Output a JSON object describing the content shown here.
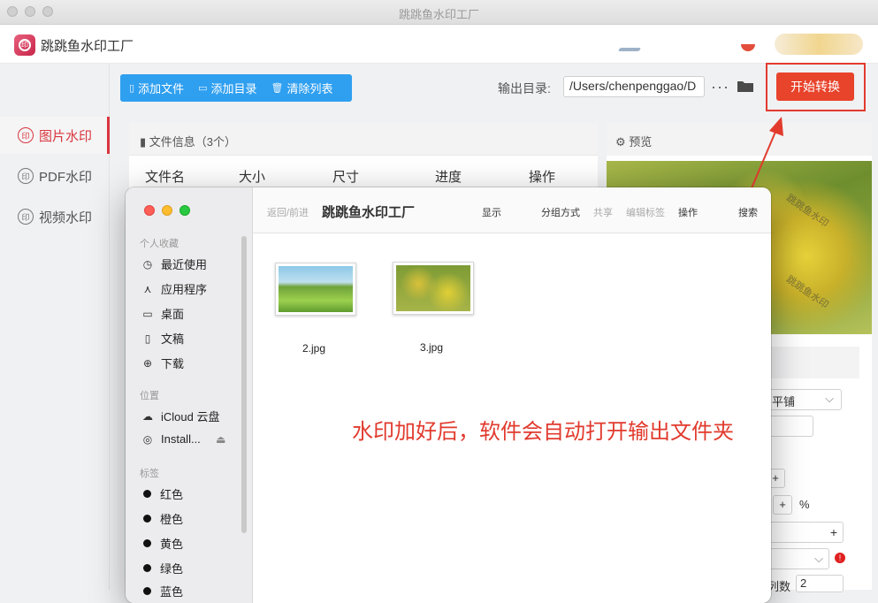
{
  "window": {
    "title": "跳跳鱼水印工厂"
  },
  "app": {
    "name": "跳跳鱼水印工厂"
  },
  "sidebar": {
    "items": [
      {
        "label": "图片水印",
        "active": true
      },
      {
        "label": "PDF水印",
        "active": false
      },
      {
        "label": "视频水印",
        "active": false
      }
    ]
  },
  "toolbar": {
    "add_file": "添加文件",
    "add_dir": "添加目录",
    "clear_list": "清除列表",
    "output_label": "输出目录:",
    "output_path": "/Users/chenpenggao/D",
    "start_button": "开始转换",
    "accent_color": "#e8432b",
    "button_group_color": "#2f9ff0"
  },
  "file_panel": {
    "title": "文件信息（3个）",
    "columns": [
      "文件名",
      "大小",
      "尺寸",
      "进度",
      "操作"
    ]
  },
  "preview": {
    "title": "预览",
    "watermark_text": "跳跳鱼水印",
    "mode_select": "平铺",
    "percent_symbol": "%",
    "plus": "+",
    "column_count_label": "列数",
    "column_count_value": "2"
  },
  "finder": {
    "nav_back_forward": "返回/前进",
    "title": "跳跳鱼水印工厂",
    "toolbar": [
      "显示",
      "分组方式",
      "共享",
      "编辑标签",
      "操作",
      "搜索"
    ],
    "sections": {
      "favorites": "个人收藏",
      "locations": "位置",
      "tags": "标签"
    },
    "favorites": [
      "最近使用",
      "应用程序",
      "桌面",
      "文稿",
      "下载"
    ],
    "locations": [
      "iCloud 云盘",
      "Install..."
    ],
    "tags": [
      "红色",
      "橙色",
      "黄色",
      "绿色",
      "蓝色"
    ],
    "files": [
      "2.jpg",
      "3.jpg"
    ]
  },
  "annotation": "水印加好后，软件会自动打开输出文件夹"
}
